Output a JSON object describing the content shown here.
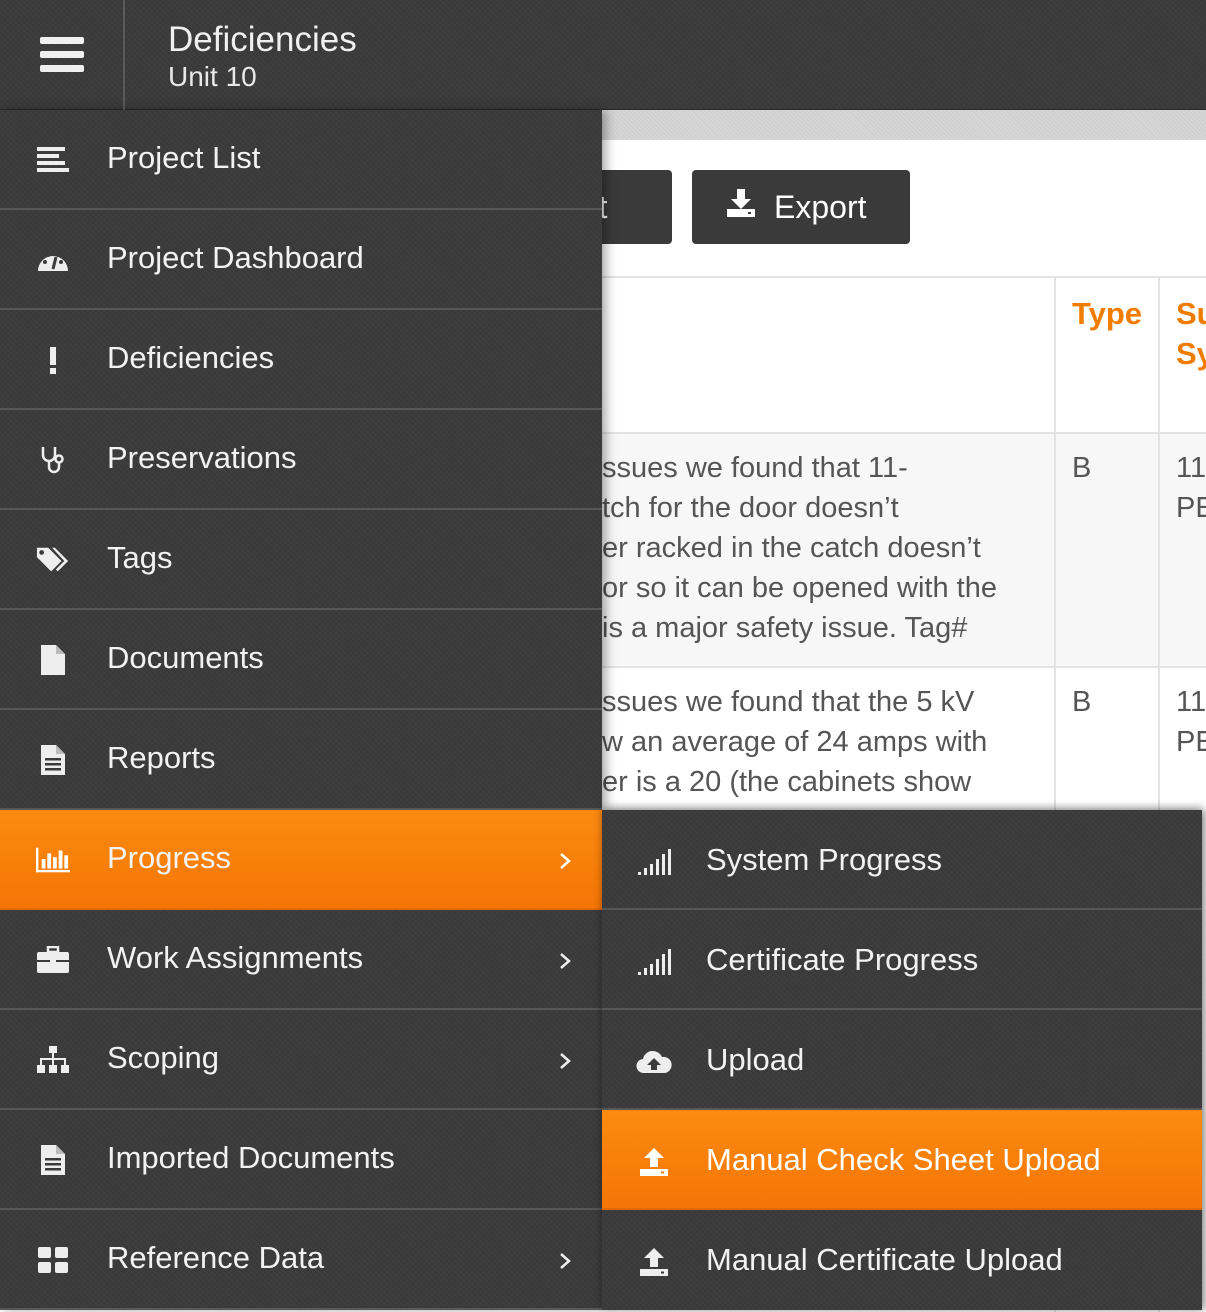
{
  "header": {
    "title": "Deficiencies",
    "subtitle": "Unit 10",
    "menu_icon": "hamburger-icon"
  },
  "toolbar": {
    "import_label_partial": "ort",
    "export_label": "Export",
    "export_icon": "download-icon"
  },
  "table": {
    "columns": [
      "Type",
      "Su",
      "Sy"
    ],
    "rows": [
      {
        "description_lines": [
          "ssues we found that 11-",
          "tch for the door doesn’t",
          "er racked in the catch doesn’t",
          "or so it can be opened with the",
          "is a major safety issue. Tag#"
        ],
        "type": "B",
        "sub_lines": [
          "11",
          "PE"
        ]
      },
      {
        "description_lines": [
          "ssues we found that the 5 kV",
          "w an average of 24 amps with",
          "er is a 20 (the cabinets show"
        ],
        "type": "B",
        "sub_lines": [
          "11",
          "PE"
        ]
      }
    ]
  },
  "menu": {
    "items": [
      {
        "label": "Project List",
        "icon": "list-icon",
        "has_submenu": false
      },
      {
        "label": "Project Dashboard",
        "icon": "dashboard-icon",
        "has_submenu": false
      },
      {
        "label": "Deficiencies",
        "icon": "exclamation-icon",
        "has_submenu": false
      },
      {
        "label": "Preservations",
        "icon": "stethoscope-icon",
        "has_submenu": false
      },
      {
        "label": "Tags",
        "icon": "tags-icon",
        "has_submenu": false
      },
      {
        "label": "Documents",
        "icon": "file-icon",
        "has_submenu": false
      },
      {
        "label": "Reports",
        "icon": "file-text-icon",
        "has_submenu": false
      },
      {
        "label": "Progress",
        "icon": "bar-chart-icon",
        "has_submenu": true,
        "active": true
      },
      {
        "label": "Work Assignments",
        "icon": "briefcase-icon",
        "has_submenu": true
      },
      {
        "label": "Scoping",
        "icon": "sitemap-icon",
        "has_submenu": true
      },
      {
        "label": "Imported Documents",
        "icon": "file-text-icon",
        "has_submenu": false
      },
      {
        "label": "Reference Data",
        "icon": "grid-icon",
        "has_submenu": true
      }
    ]
  },
  "submenu": {
    "items": [
      {
        "label": "System Progress",
        "icon": "signal-icon"
      },
      {
        "label": "Certificate Progress",
        "icon": "signal-icon"
      },
      {
        "label": "Upload",
        "icon": "cloud-upload-icon"
      },
      {
        "label": "Manual Check Sheet Upload",
        "icon": "upload-icon",
        "active": true
      },
      {
        "label": "Manual Certificate Upload",
        "icon": "upload-icon"
      }
    ]
  },
  "colors": {
    "accent": "#f57f0a",
    "header_text": "#f07d00",
    "menu_bg": "#3b3b3b"
  }
}
